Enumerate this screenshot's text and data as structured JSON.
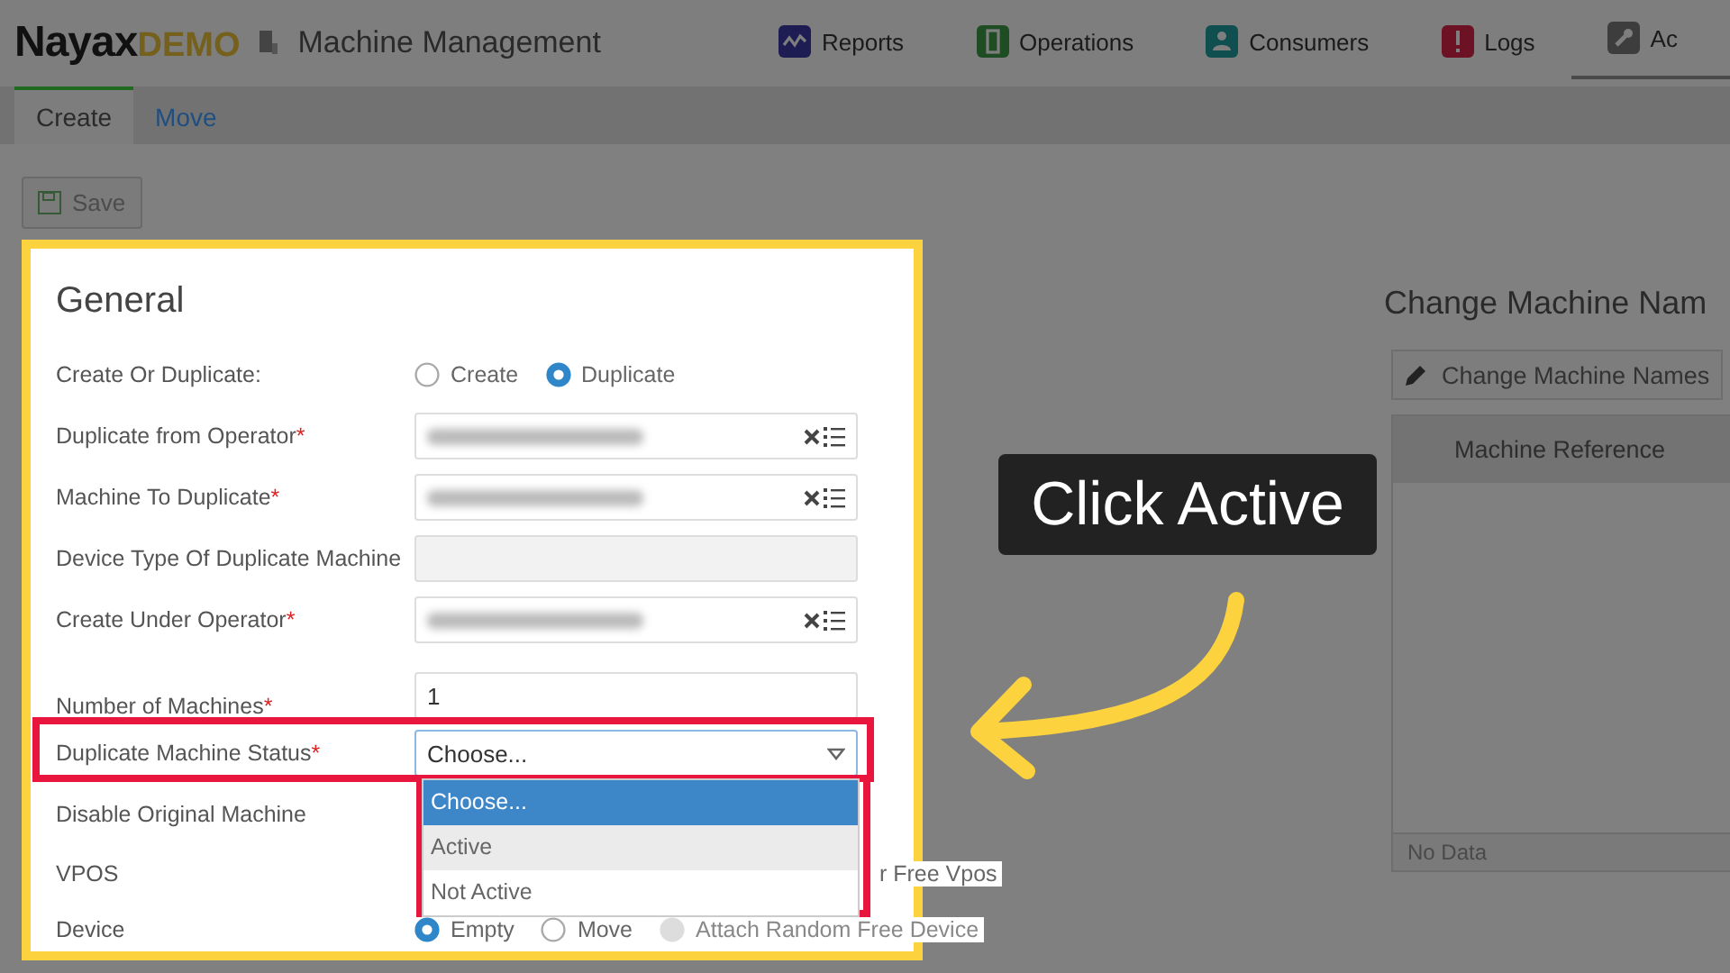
{
  "header": {
    "brand": "Nayax",
    "brand_suffix": "DEMO",
    "title": "Machine Management",
    "nav": [
      {
        "label": "Reports",
        "color": "#1d1d54",
        "selected": false
      },
      {
        "label": "Operations",
        "color": "#1f4d23",
        "selected": false
      },
      {
        "label": "Consumers",
        "color": "#104f4f",
        "selected": false
      },
      {
        "label": "Logs",
        "color": "#6d1125",
        "selected": false
      },
      {
        "label": "Ac",
        "color": "#3d3d3d",
        "selected": true
      }
    ]
  },
  "tabs": [
    {
      "label": "Create",
      "selected": true
    },
    {
      "label": "Move",
      "selected": false
    }
  ],
  "save_button": {
    "label": "Save",
    "disabled": true
  },
  "form": {
    "title": "General",
    "rows": [
      {
        "kind": "radio",
        "label": "Create Or Duplicate:",
        "options": [
          {
            "label": "Create",
            "selected": false,
            "disabled": false
          },
          {
            "label": "Duplicate",
            "selected": true,
            "disabled": false
          }
        ]
      },
      {
        "kind": "lookup",
        "label": "Duplicate from Operator",
        "required": "*"
      },
      {
        "kind": "lookup",
        "label": "Machine To Duplicate",
        "required": "*"
      },
      {
        "kind": "readonly",
        "label": "Device Type Of Duplicate Machine"
      },
      {
        "kind": "lookup",
        "label": "Create Under Operator",
        "required": "*"
      },
      {
        "kind": "text",
        "label": "Number of Machines",
        "required": "*",
        "value": "1"
      },
      {
        "kind": "select",
        "label": "Duplicate Machine Status",
        "required": "*",
        "value": "Choose...",
        "open": true,
        "options": [
          {
            "label": "Choose...",
            "selected": true,
            "hovered": false
          },
          {
            "label": "Active",
            "selected": false,
            "hovered": true
          },
          {
            "label": "Not Active",
            "selected": false,
            "hovered": false
          }
        ]
      },
      {
        "kind": "blank",
        "label": "Disable Original Machine"
      },
      {
        "kind": "covered",
        "label": "VPOS",
        "tail": "r Free Vpos"
      },
      {
        "kind": "radio",
        "label": "Device",
        "options": [
          {
            "label": "Empty",
            "selected": true,
            "disabled": false
          },
          {
            "label": "Move",
            "selected": false,
            "disabled": false
          },
          {
            "label": "Attach Random Free Device",
            "selected": false,
            "disabled": true
          }
        ]
      }
    ]
  },
  "side_panel": {
    "title": "Change Machine Nam",
    "button": "Change Machine Names",
    "table": {
      "columns": [
        "Machine Reference"
      ],
      "footer": "No Data"
    }
  },
  "annotation": {
    "callout": "Click Active"
  }
}
